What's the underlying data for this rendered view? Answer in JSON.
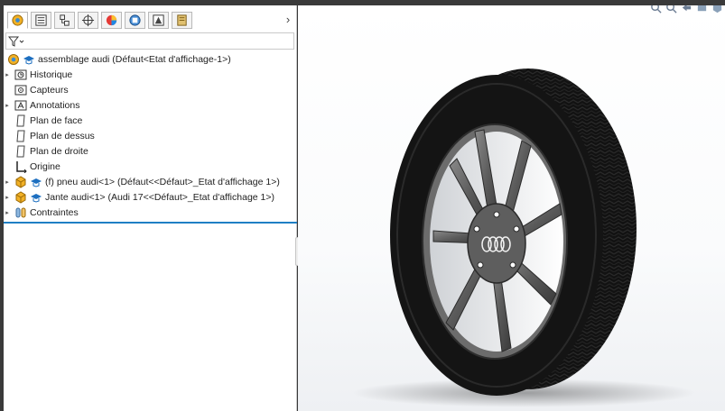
{
  "feature_manager": {
    "tabs": [
      {
        "name": "featuremanager-tab",
        "icon": "feature-tree-icon",
        "active": true
      },
      {
        "name": "propertymanager-tab",
        "icon": "property-manager-icon",
        "active": false
      },
      {
        "name": "configurationmanager-tab",
        "icon": "configuration-manager-icon",
        "active": false
      },
      {
        "name": "dimxpert-tab",
        "icon": "dimxpert-icon",
        "active": false
      },
      {
        "name": "display-manager-tab",
        "icon": "appearance-sphere-icon",
        "active": false
      },
      {
        "name": "cam-tab",
        "icon": "cam-icon",
        "active": false
      },
      {
        "name": "simulation-tab",
        "icon": "simulation-icon",
        "active": false
      },
      {
        "name": "motion-tab",
        "icon": "motion-icon",
        "active": false
      }
    ],
    "tab_overflow_glyph": "›",
    "tree": {
      "root": {
        "label": "assemblage audi  (Défaut<Etat d'affichage-1>)",
        "icon": "assembly-icon"
      },
      "items": [
        {
          "label": "Historique",
          "icon": "history-folder-icon",
          "expandable": true
        },
        {
          "label": "Capteurs",
          "icon": "sensors-icon",
          "expandable": false
        },
        {
          "label": "Annotations",
          "icon": "annotations-icon",
          "expandable": true
        },
        {
          "label": "Plan de face",
          "icon": "plane-icon",
          "expandable": false
        },
        {
          "label": "Plan de dessus",
          "icon": "plane-icon",
          "expandable": false
        },
        {
          "label": "Plan de droite",
          "icon": "plane-icon",
          "expandable": false
        },
        {
          "label": "Origine",
          "icon": "origin-icon",
          "expandable": false
        },
        {
          "label": "(f) pneu audi<1> (Défaut<<Défaut>_Etat d'affichage 1>)",
          "icon": "part-icon",
          "expandable": true
        },
        {
          "label": "Jante audi<1> (Audi 17<<Défaut>_Etat d'affichage 1>)",
          "icon": "part-icon",
          "expandable": true
        },
        {
          "label": "Contraintes",
          "icon": "mates-icon",
          "expandable": true
        }
      ]
    }
  },
  "viewport": {
    "model": "audi-wheel-assembly",
    "heads_up_icons": [
      "zoom-to-fit-icon",
      "zoom-area-icon",
      "previous-view-icon",
      "section-view-icon",
      "view-orientation-icon"
    ]
  },
  "colors": {
    "accent": "#1f7fc4",
    "frame": "#3a3a3a",
    "tire": "#141414",
    "rim": "#5b5b5b"
  }
}
